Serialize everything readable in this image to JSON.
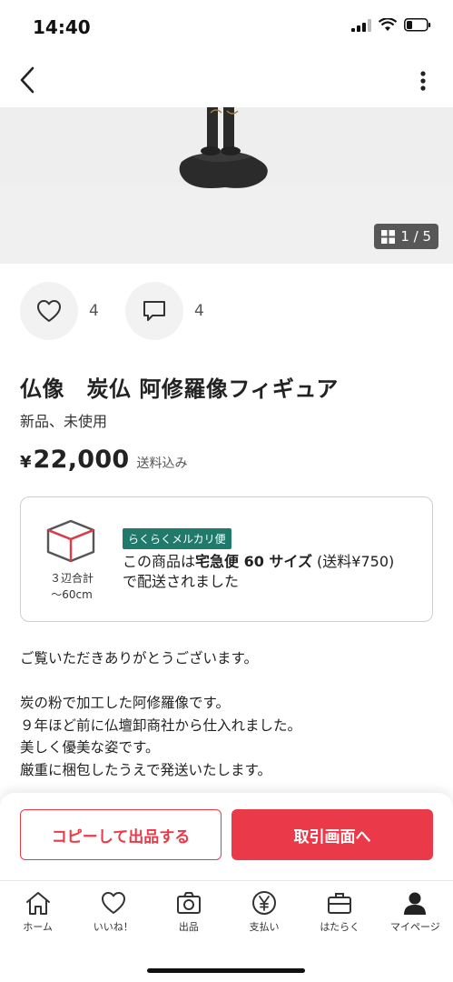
{
  "status_bar": {
    "time": "14:40"
  },
  "photo": {
    "counter": "1 / 5"
  },
  "actions": {
    "likes": "4",
    "comments": "4"
  },
  "item": {
    "title": "仏像　炭仏 阿修羅像フィギュア",
    "condition": "新品、未使用",
    "price_symbol": "¥",
    "price": "22,000",
    "shipping_included": "送料込み"
  },
  "shipping": {
    "size_caption_line1": "３辺合計",
    "size_caption_line2": "～60cm",
    "badge": "らくらくメルカリ便",
    "text_prefix": "この商品は",
    "text_bold": "宅急便 60 サイズ",
    "text_suffix": " (送料¥750) で配送されました"
  },
  "description": {
    "line1": "ご覧いただきありがとうございます。",
    "line2": "炭の粉で加工した阿修羅像です。",
    "line3": "９年ほど前に仏壇卸商社から仕入れました。",
    "line4": "美しく優美な姿です。",
    "line5": "厳重に梱包したうえで発送いたします。"
  },
  "buttons": {
    "copy_listing": "コピーして出品する",
    "to_trade": "取引画面へ"
  },
  "tabbar": [
    {
      "label": "ホーム",
      "icon": "home-icon"
    },
    {
      "label": "いいね！",
      "icon": "heart-icon"
    },
    {
      "label": "出品",
      "icon": "camera-icon"
    },
    {
      "label": "支払い",
      "icon": "yen-icon"
    },
    {
      "label": "はたらく",
      "icon": "briefcase-icon"
    },
    {
      "label": "マイページ",
      "icon": "person-icon"
    }
  ],
  "colors": {
    "accent": "#ea3a4a",
    "badge": "#1f7a6b",
    "photo_bg": "#eeeeee"
  }
}
